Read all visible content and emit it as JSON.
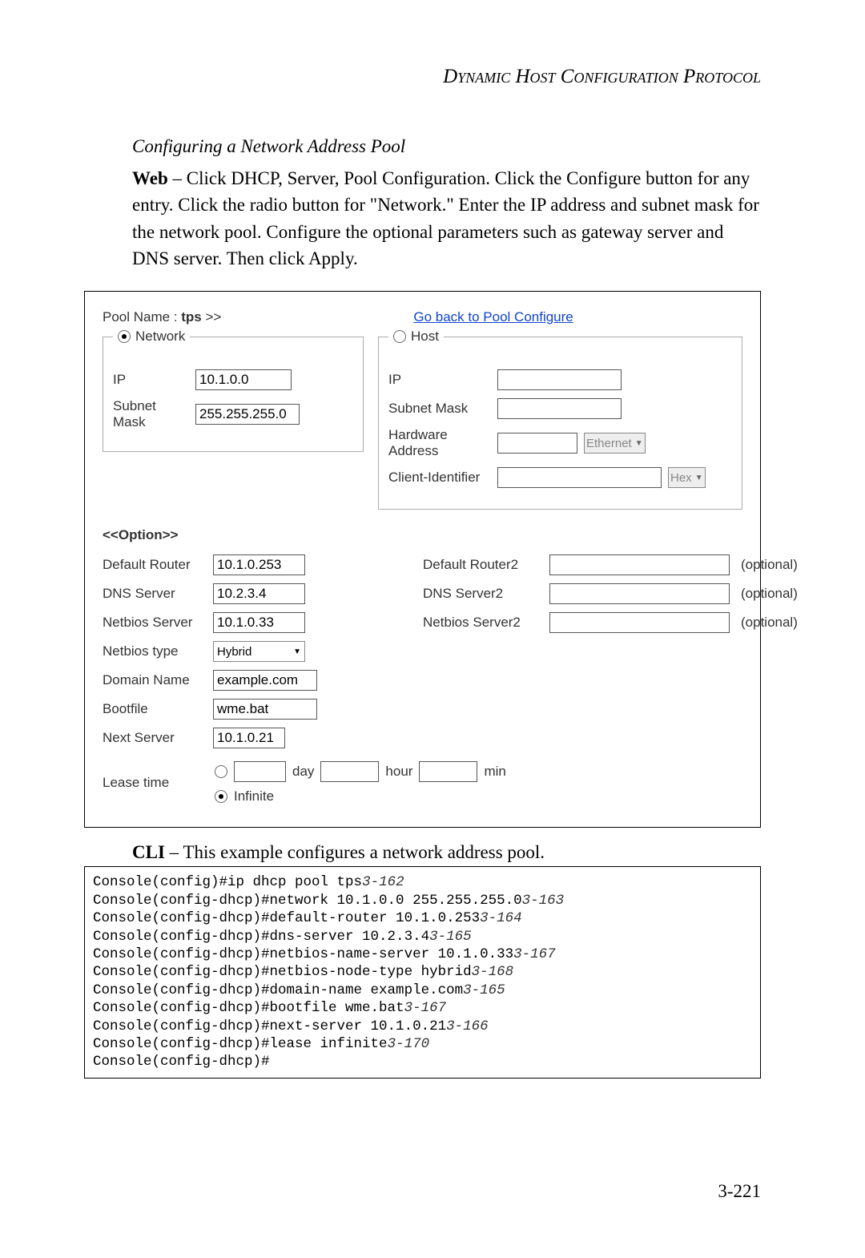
{
  "chapter_title": "Dynamic Host Configuration Protocol",
  "section_title": "Configuring a Network Address Pool",
  "body_prefix_bold": "Web",
  "body_text": " – Click DHCP, Server, Pool Configuration. Click the Configure button for any entry. Click the radio button for \"Network.\" Enter the IP address and subnet mask for the network pool. Configure the optional parameters such as gateway server and DNS server. Then click Apply.",
  "panel": {
    "pool_name_label": "Pool Name : ",
    "pool_name_value": "tps",
    "pool_name_suffix": " >>",
    "go_back": "Go back to Pool Configure",
    "network": {
      "legend": "Network",
      "ip_label": "IP",
      "ip_value": "10.1.0.0",
      "mask_label": "Subnet Mask",
      "mask_value": "255.255.255.0"
    },
    "host": {
      "legend": "Host",
      "ip_label": "IP",
      "mask_label": "Subnet Mask",
      "hw_label": "Hardware Address",
      "hw_type": "Ethernet",
      "cid_label": "Client-Identifier",
      "cid_mode": "Hex"
    },
    "option_header": "<<Option>>",
    "opts": {
      "default_router_l": "Default Router",
      "default_router_v": "10.1.0.253",
      "default_router2_l": "Default Router2",
      "dns_l": "DNS Server",
      "dns_v": "10.2.3.4",
      "dns2_l": "DNS Server2",
      "nb_l": "Netbios Server",
      "nb_v": "10.1.0.33",
      "nb2_l": "Netbios Server2",
      "optional": "(optional)",
      "nbtype_l": "Netbios type",
      "nbtype_v": "Hybrid",
      "domain_l": "Domain Name",
      "domain_v": "example.com",
      "bootfile_l": "Bootfile",
      "bootfile_v": "wme.bat",
      "nextsrv_l": "Next Server",
      "nextsrv_v": "10.1.0.21",
      "lease_l": "Lease time",
      "day": "day",
      "hour": "hour",
      "min": "min",
      "infinite": "Infinite"
    }
  },
  "cli_prefix_bold": "CLI",
  "cli_intro": " – This example configures a network address pool.",
  "cli": [
    {
      "t": "Console(config)#ip dhcp pool tps",
      "r": "3-162"
    },
    {
      "t": "Console(config-dhcp)#network 10.1.0.0 255.255.255.0",
      "r": "3-163"
    },
    {
      "t": "Console(config-dhcp)#default-router 10.1.0.253",
      "r": "3-164"
    },
    {
      "t": "Console(config-dhcp)#dns-server 10.2.3.4",
      "r": "3-165"
    },
    {
      "t": "Console(config-dhcp)#netbios-name-server 10.1.0.33",
      "r": "3-167"
    },
    {
      "t": "Console(config-dhcp)#netbios-node-type hybrid",
      "r": "3-168"
    },
    {
      "t": "Console(config-dhcp)#domain-name example.com",
      "r": "3-165"
    },
    {
      "t": "Console(config-dhcp)#bootfile wme.bat",
      "r": "3-167"
    },
    {
      "t": "Console(config-dhcp)#next-server 10.1.0.21",
      "r": "3-166"
    },
    {
      "t": "Console(config-dhcp)#lease infinite",
      "r": "3-170"
    },
    {
      "t": "Console(config-dhcp)#",
      "r": ""
    }
  ],
  "page_number": "3-221"
}
